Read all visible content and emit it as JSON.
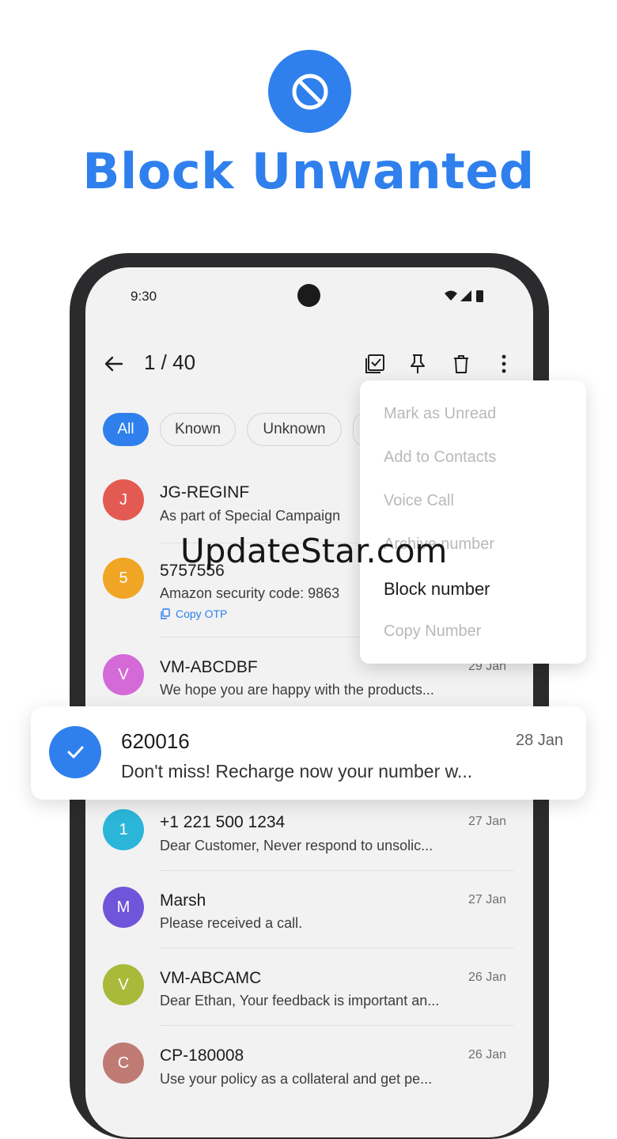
{
  "hero": {
    "title": "Block Unwanted",
    "icon": "block-icon",
    "color": "#2f80ed"
  },
  "status_bar": {
    "time": "9:30"
  },
  "toolbar": {
    "count": "1 / 40",
    "icons": [
      "back-arrow-icon",
      "select-all-icon",
      "pin-icon",
      "delete-icon",
      "more-icon"
    ]
  },
  "filters": {
    "chips": [
      "All",
      "Known",
      "Unknown"
    ],
    "selected": "All"
  },
  "messages": [
    {
      "sender": "JG-REGINF",
      "preview": "As part of Special Campaign",
      "date": "",
      "avatar": "J",
      "color": "#e35a52"
    },
    {
      "sender": "5757556",
      "preview": "Amazon security code: 9863",
      "date": "",
      "avatar": "5",
      "color": "#f0a624",
      "action": "Copy OTP"
    },
    {
      "sender": "VM-ABCDBF",
      "preview": "We hope you are happy with the products...",
      "date": "29 Jan",
      "avatar": "V",
      "color": "#d36ad8"
    },
    {
      "sender": "+1 221 500 1234",
      "preview": "Dear Customer, Never respond to unsolic...",
      "date": "27 Jan",
      "avatar": "1",
      "color": "#2bb6d9"
    },
    {
      "sender": "Marsh",
      "preview": "Please received a call.",
      "date": "27 Jan",
      "avatar": "M",
      "color": "#6f55d9"
    },
    {
      "sender": "VM-ABCAMC",
      "preview": "Dear Ethan, Your feedback is important an...",
      "date": "26 Jan",
      "avatar": "V",
      "color": "#a9ba3a"
    },
    {
      "sender": "CP-180008",
      "preview": "Use your policy as a collateral and get pe...",
      "date": "26 Jan",
      "avatar": "C",
      "color": "#c07a74"
    }
  ],
  "selected_message": {
    "sender": "620016",
    "preview": "Don't miss! Recharge now your number w...",
    "date": "28 Jan"
  },
  "menu": {
    "items": [
      "Mark as Unread",
      "Add to Contacts",
      "Voice Call",
      "Archive number",
      "Block number",
      "Copy Number"
    ],
    "active": "Block number"
  },
  "watermark": "UpdateStar.com"
}
